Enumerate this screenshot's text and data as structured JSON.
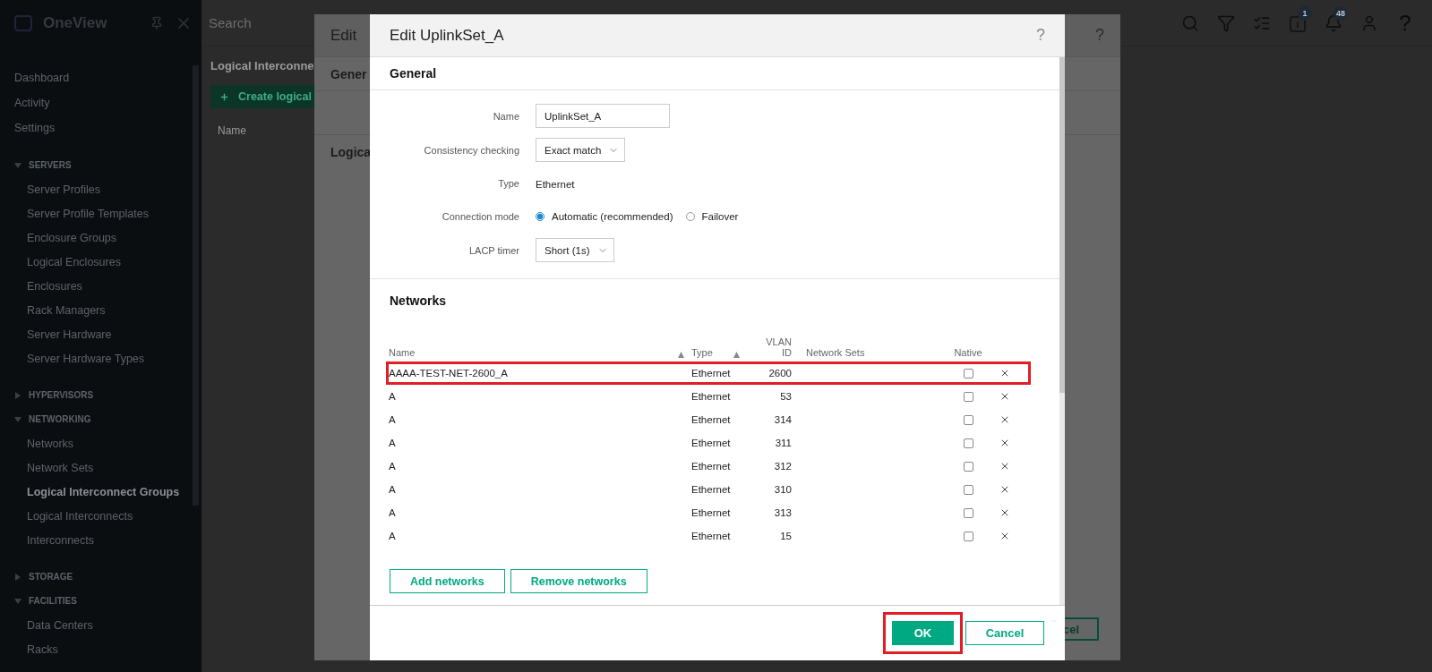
{
  "app": {
    "logo": "OneView",
    "search_placeholder": "Search",
    "activity_badge": "1",
    "notifications_badge": "48",
    "help": "?"
  },
  "sidebar": {
    "items": [
      {
        "kind": "link",
        "label": "Dashboard"
      },
      {
        "kind": "link",
        "label": "Activity"
      },
      {
        "kind": "link",
        "label": "Settings"
      },
      {
        "kind": "section",
        "label": "SERVERS",
        "expanded": true,
        "children": [
          {
            "label": "Server Profiles",
            "selected": false
          },
          {
            "label": "Server Profile Templates",
            "selected": false
          },
          {
            "label": "Enclosure Groups",
            "selected": false
          },
          {
            "label": "Logical Enclosures",
            "selected": false
          },
          {
            "label": "Enclosures",
            "selected": false
          },
          {
            "label": "Rack Managers",
            "selected": false
          },
          {
            "label": "Server Hardware",
            "selected": false
          },
          {
            "label": "Server Hardware Types",
            "selected": false
          }
        ]
      },
      {
        "kind": "section",
        "label": "HYPERVISORS",
        "expanded": false
      },
      {
        "kind": "section",
        "label": "NETWORKING",
        "expanded": true,
        "children": [
          {
            "label": "Networks",
            "selected": false
          },
          {
            "label": "Network Sets",
            "selected": false
          },
          {
            "label": "Logical Interconnect Groups",
            "selected": true
          },
          {
            "label": "Logical Interconnects",
            "selected": false
          },
          {
            "label": "Interconnects",
            "selected": false
          }
        ]
      },
      {
        "kind": "section",
        "label": "STORAGE",
        "expanded": false
      },
      {
        "kind": "section",
        "label": "FACILITIES",
        "expanded": true,
        "children": [
          {
            "label": "Data Centers",
            "selected": false
          },
          {
            "label": "Racks",
            "selected": false
          }
        ]
      }
    ]
  },
  "background_page": {
    "title": "Logical Interconne",
    "create_button": "Create logical",
    "column": "Name"
  },
  "background_dialog": {
    "title": "Edit",
    "help": "?",
    "section_1": "Gener",
    "section_2": "Logica",
    "cancel_fragment": "cel"
  },
  "dialog": {
    "title": "Edit UplinkSet_A",
    "help": "?",
    "general": {
      "heading": "General",
      "fields": [
        {
          "kind": "text",
          "label": "Name",
          "value": "UplinkSet_A"
        },
        {
          "kind": "select",
          "label": "Consistency checking",
          "value": "Exact match"
        },
        {
          "kind": "static",
          "label": "Type",
          "value": "Ethernet"
        },
        {
          "kind": "radio",
          "label": "Connection mode",
          "options": [
            {
              "label": "Automatic (recommended)",
              "selected": true
            },
            {
              "label": "Failover",
              "selected": false
            }
          ]
        },
        {
          "kind": "select",
          "label": "LACP timer",
          "value": "Short (1s)"
        }
      ]
    },
    "networks": {
      "heading": "Networks",
      "columns": [
        "Name",
        "Type",
        "VLAN ID",
        "Network Sets",
        "Native"
      ],
      "rows": [
        {
          "name": "AAAA-TEST-NET-2600_A",
          "type": "Ethernet",
          "vlan_id": "2600",
          "native": false,
          "highlighted": true
        },
        {
          "name": "A",
          "type": "Ethernet",
          "vlan_id": "53",
          "native": false,
          "highlighted": false
        },
        {
          "name": "A",
          "type": "Ethernet",
          "vlan_id": "314",
          "native": false,
          "highlighted": false
        },
        {
          "name": "A",
          "type": "Ethernet",
          "vlan_id": "311",
          "native": false,
          "highlighted": false
        },
        {
          "name": "A",
          "type": "Ethernet",
          "vlan_id": "312",
          "native": false,
          "highlighted": false
        },
        {
          "name": "A",
          "type": "Ethernet",
          "vlan_id": "310",
          "native": false,
          "highlighted": false
        },
        {
          "name": "A",
          "type": "Ethernet",
          "vlan_id": "313",
          "native": false,
          "highlighted": false
        },
        {
          "name": "A",
          "type": "Ethernet",
          "vlan_id": "15",
          "native": false,
          "highlighted": false
        }
      ],
      "buttons": [
        "Add networks",
        "Remove networks"
      ]
    },
    "ok_button": {
      "label": "OK",
      "highlighted": true
    },
    "cancel_button": "Cancel"
  }
}
